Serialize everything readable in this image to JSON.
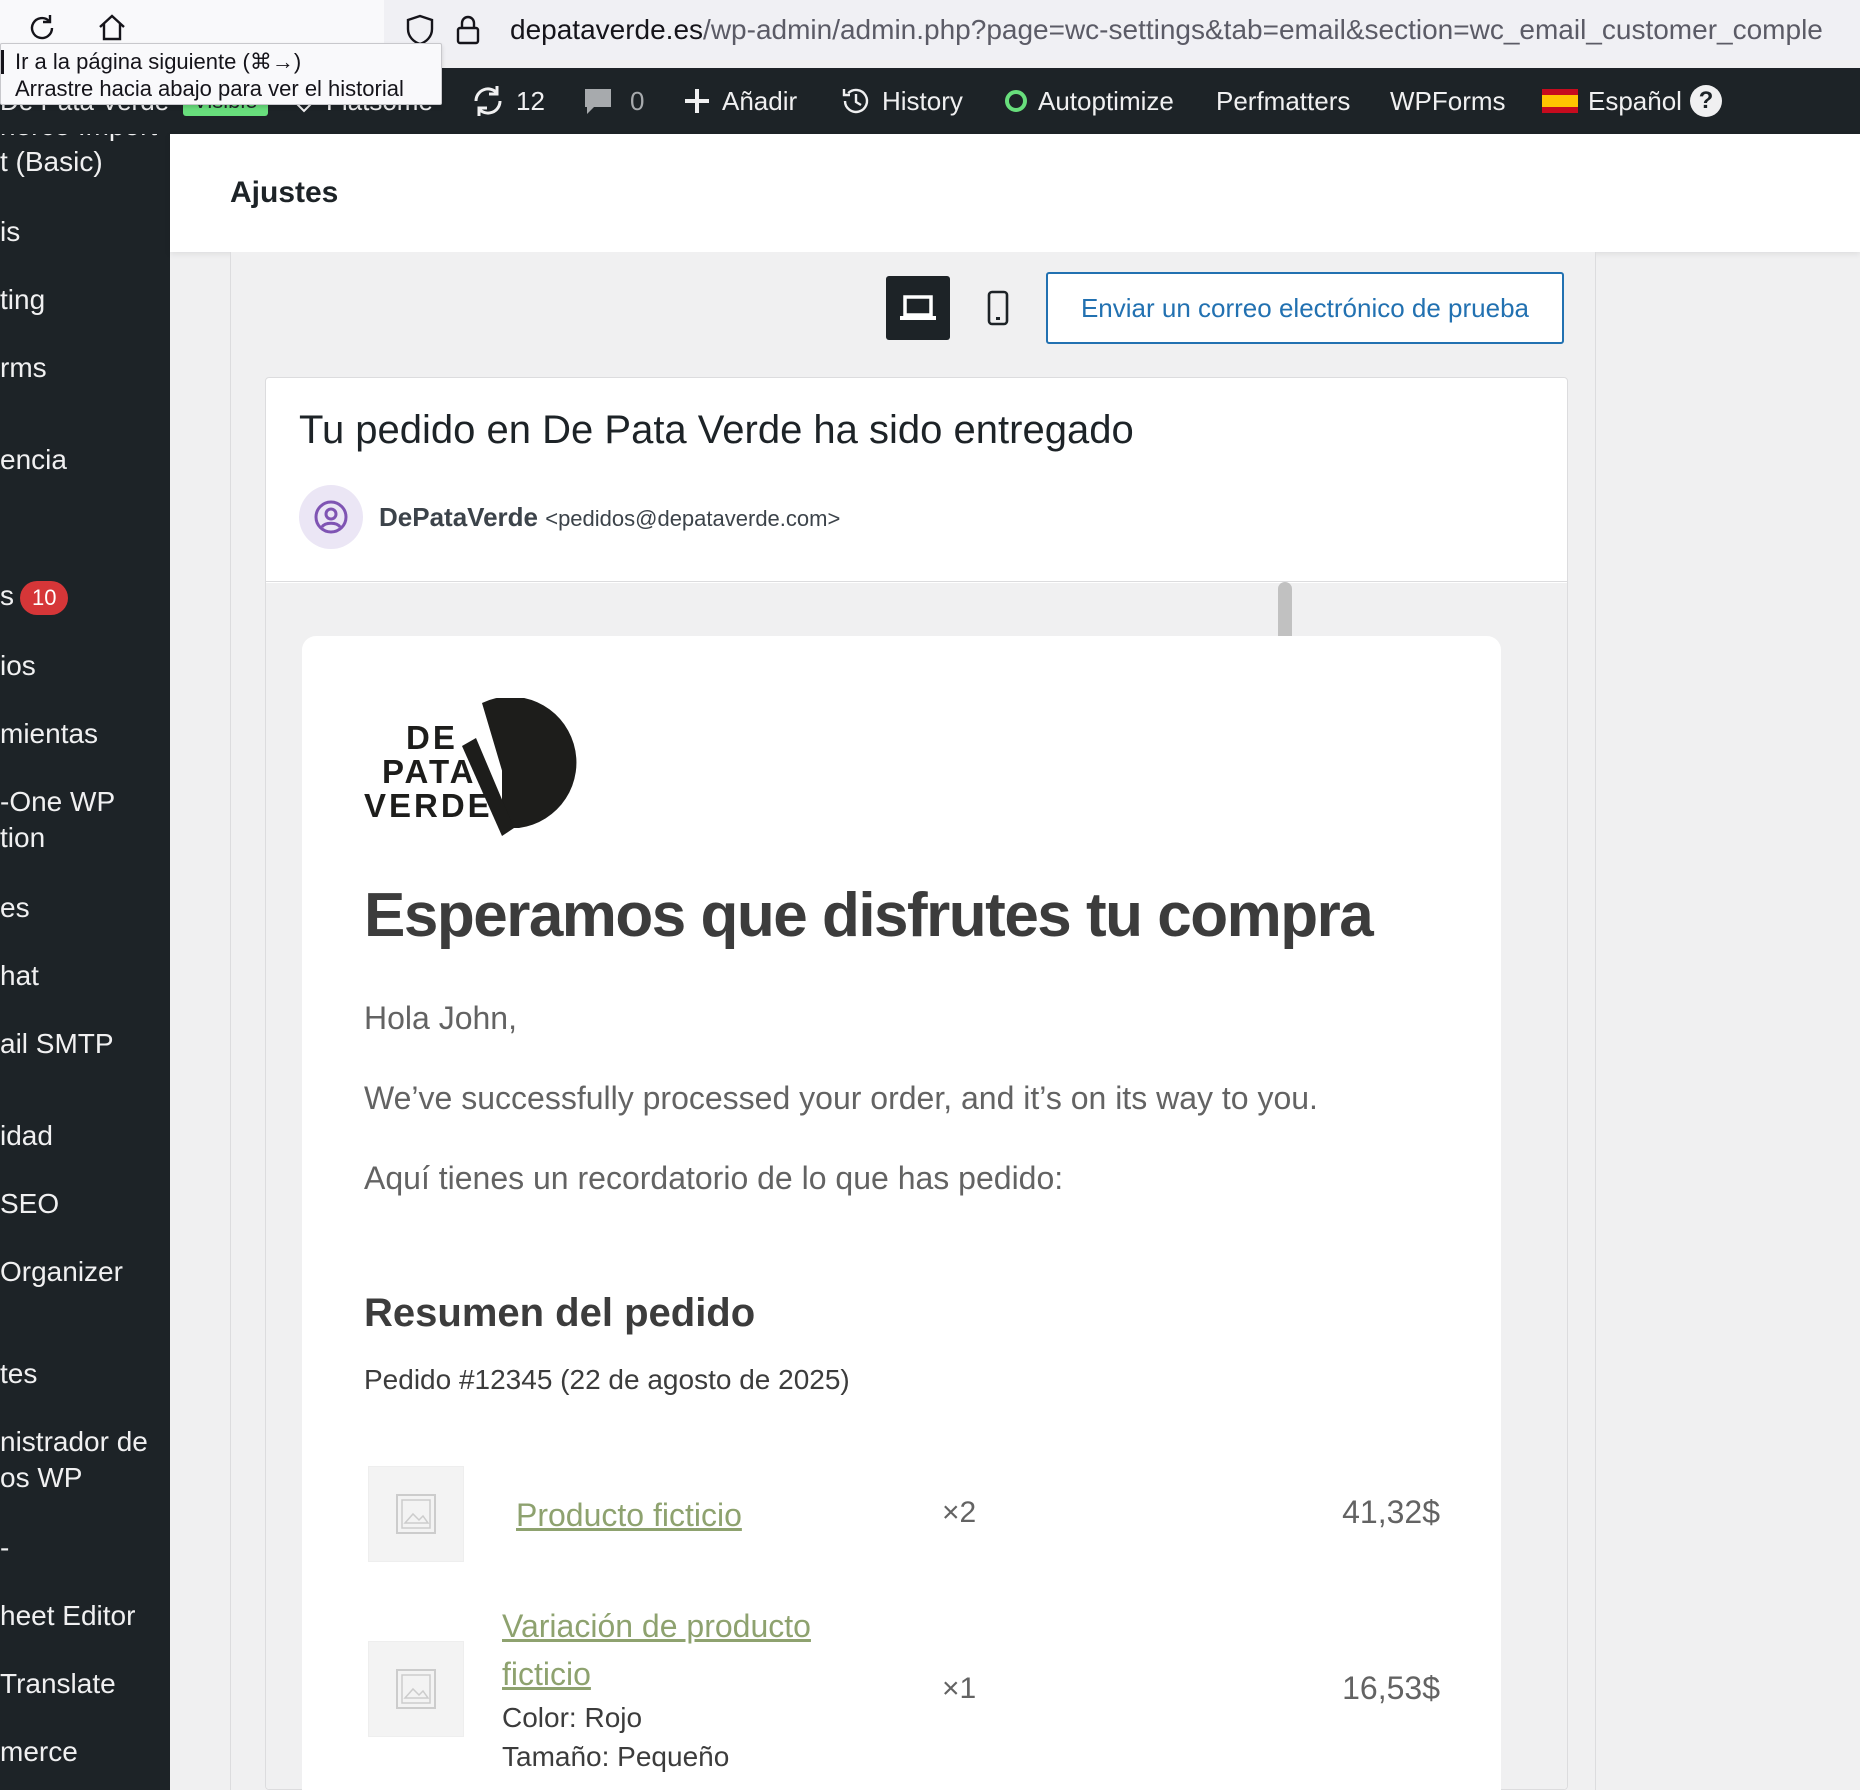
{
  "browser": {
    "url_host": "depataverde.es",
    "url_path": "/wp-admin/admin.php?page=wc-settings&tab=email&section=wc_email_customer_comple",
    "tooltip_line1": "Ir a la página siguiente (⌘→)",
    "tooltip_line2": "Arrastre hacia abajo para ver el historial"
  },
  "adminbar": {
    "site_name": "De Pata Verde",
    "visible_badge": "Visible",
    "theme": "Flatsome",
    "updates_count": "12",
    "comments_count": "0",
    "add_new": "Añadir",
    "history": "History",
    "autoptimize": "Autoptimize",
    "perfmatters": "Perfmatters",
    "wpforms": "WPForms",
    "language": "Español",
    "help": "?"
  },
  "sidebar": {
    "items": [
      "nerce Import",
      "t (Basic)",
      "is",
      "ting",
      "rms",
      "encia",
      "s",
      "ios",
      "mientas",
      "-One WP",
      "tion",
      "es",
      "hat",
      "ail SMTP",
      "idad",
      "SEO",
      " Organizer",
      "tes",
      "nistrador de",
      "os WP",
      "-",
      "heet Editor",
      "Translate",
      "merce"
    ],
    "badge": "10"
  },
  "header": {
    "title": "Ajustes"
  },
  "preview": {
    "send_test_label": "Enviar un correo electrónico de prueba",
    "subject": "Tu pedido en De Pata Verde ha sido entregado",
    "sender_name": "DePataVerde",
    "sender_email": "<pedidos@depataverde.com>"
  },
  "email": {
    "logo_line1": "DE",
    "logo_line2": "PATA",
    "logo_line3": "VERDE",
    "heading": "Esperamos que disfrutes tu compra",
    "greeting": "Hola John,",
    "processed": "We’ve successfully processed your order, and it’s on its way to you.",
    "reminder": "Aquí tienes un recordatorio de lo que has pedido:",
    "summary_title": "Resumen del pedido",
    "order_line": "Pedido #12345 (22 de agosto de 2025)",
    "items": [
      {
        "name": "Producto ficticio",
        "qty": "×2",
        "price": "41,32$"
      },
      {
        "name_line1": "Variación de producto",
        "name_line2": "ficticio",
        "color": "Color: Rojo",
        "size": "Tamaño: Pequeño",
        "qty": "×1",
        "price": "16,53$"
      }
    ]
  },
  "colors": {
    "admin_dark": "#1d2327",
    "wp_blue": "#2271b1",
    "link_green": "#8ea26f",
    "badge_red": "#d63638"
  }
}
